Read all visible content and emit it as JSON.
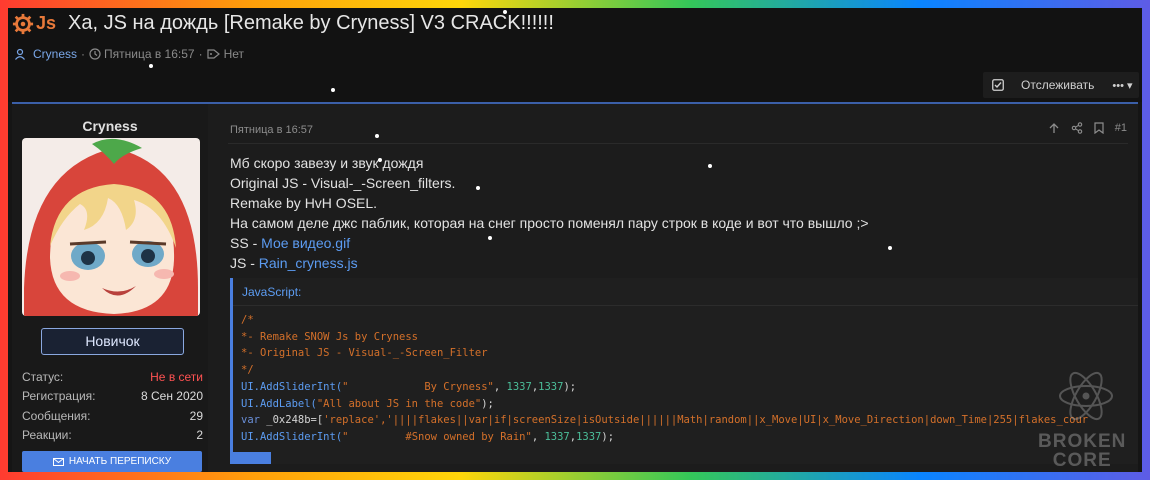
{
  "thread": {
    "prefix": "Js",
    "title": "Ха, JS на дождь [Remake by Cryness] V3 CRACK!!!!!!",
    "author": "Cryness",
    "date": "Пятница в 16:57",
    "tags": "Нет"
  },
  "toolbar": {
    "watch_label": "Отслеживать",
    "more_label": "•••"
  },
  "user": {
    "name": "Cryness",
    "rank": "Новичок",
    "stats": [
      {
        "label": "Статус:",
        "value": "Не в сети"
      },
      {
        "label": "Регистрация:",
        "value": "8 Сен 2020"
      },
      {
        "label": "Сообщения:",
        "value": "29"
      },
      {
        "label": "Реакции:",
        "value": "2"
      }
    ],
    "pm_button": "НАЧАТЬ ПЕРЕПИСКУ"
  },
  "post": {
    "date": "Пятница в 16:57",
    "number": "#1",
    "lines": [
      "Мб скоро завезу и звук дождя",
      "Original JS - Visual-_-Screen_filters.",
      "Remake by HvH OSEL.",
      "На самом деле джс паблик, которая на снег просто поменял пару строк в коде и вот что вышло ;>"
    ],
    "ss_label": "SS - ",
    "ss_link": "Мое видео.gif",
    "js_label": "JS - ",
    "js_link": "Rain_cryness.js"
  },
  "code": {
    "language": "JavaScript:",
    "lines": {
      "l1": "/*",
      "l2": "*- Remake SNOW Js by Cryness",
      "l3": "*- Original JS - Visual-_-Screen_Filter",
      "l4": "*/",
      "l5_fn": "UI.AddSliderInt(",
      "l5_str": "\"            By Cryness\"",
      "l5_n1": "1337",
      "l5_n2": "1337",
      "l6_fn": "UI.AddLabel(",
      "l6_str": "\"All about JS in the code\"",
      "l7_kw": "var",
      "l7_var": " _0x248b=[",
      "l7_str": "'replace'",
      "l7_rest": ",'||||flakes||var|if|screenSize|isOutside||||||Math|random||x_Move|UI|x_Move_Direction|down_Time|255|flakes_cour",
      "l8_fn": "UI.AddSliderInt(",
      "l8_str": "\"         #Snow owned by Rain\"",
      "l8_n1": "1337",
      "l8_n2": "1337"
    }
  },
  "branding": {
    "line1": "BROKEN",
    "line2": "CORE"
  }
}
